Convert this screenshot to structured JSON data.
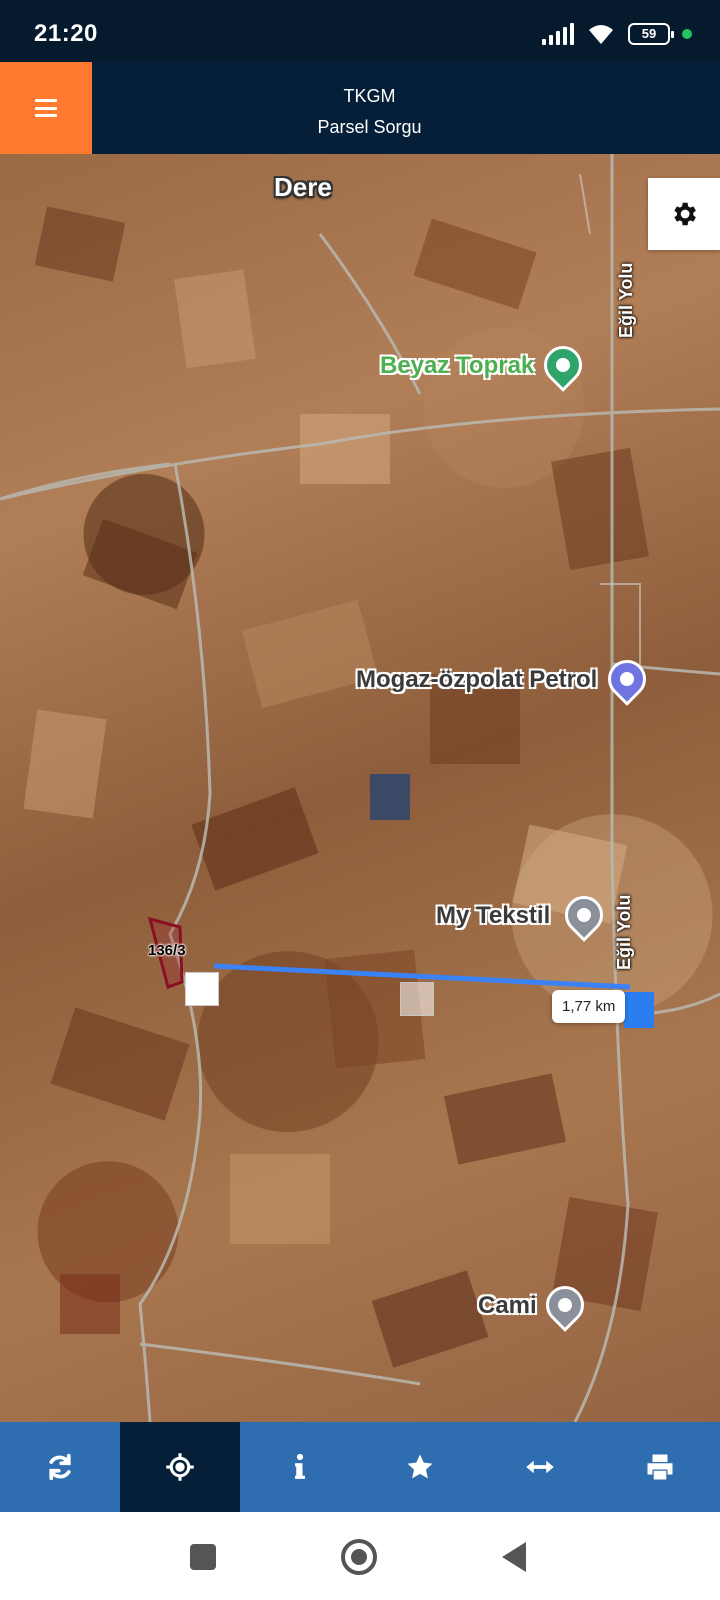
{
  "status_bar": {
    "time": "21:20",
    "battery": "59",
    "icons": [
      "signal-icon",
      "wifi-icon",
      "battery-icon",
      "dot-indicator"
    ]
  },
  "header": {
    "title": "TKGM",
    "subtitle": "Parsel Sorgu",
    "menu_icon": "hamburger-menu-icon",
    "accent_color": "#ff7a2f",
    "background_color": "#061f38"
  },
  "map": {
    "labels": {
      "dere": "Dere",
      "beyaz_toprak": "Beyaz Toprak",
      "mogaz": "Mogaz-özpolat Petrol",
      "my_tekstil": "My Tekstil",
      "cami": "Cami"
    },
    "road_labels": {
      "north": "Eğil Yolu",
      "south": "Eğil Yolu"
    },
    "parcel_label": "136/3",
    "measurement": "1,77 km",
    "settings_icon": "gear-icon"
  },
  "toolbar": {
    "active_index": 1,
    "items": [
      {
        "name": "refresh",
        "icon": "refresh-icon"
      },
      {
        "name": "locate",
        "icon": "crosshair-icon"
      },
      {
        "name": "info",
        "icon": "info-icon"
      },
      {
        "name": "favorites",
        "icon": "star-icon"
      },
      {
        "name": "measure",
        "icon": "arrows-horizontal-icon"
      },
      {
        "name": "print",
        "icon": "print-icon"
      }
    ]
  },
  "navbar": {
    "icons": [
      "recent-apps-icon",
      "home-icon",
      "back-icon"
    ]
  }
}
